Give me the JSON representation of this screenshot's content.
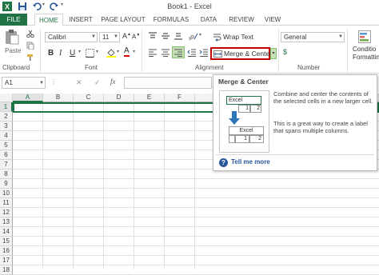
{
  "window": {
    "title": "Book1 - Excel"
  },
  "tabs": [
    "FILE",
    "HOME",
    "INSERT",
    "PAGE LAYOUT",
    "FORMULAS",
    "DATA",
    "REVIEW",
    "VIEW"
  ],
  "ribbon": {
    "clipboard": {
      "label": "Clipboard",
      "paste_label": "Paste"
    },
    "font": {
      "label": "Font",
      "font_name": "Calibri",
      "font_size": "11"
    },
    "alignment": {
      "label": "Alignment",
      "wrap_text": "Wrap Text",
      "merge_center": "Merge & Center"
    },
    "number": {
      "label": "Number",
      "format": "General"
    },
    "styles": {
      "conditional_line1": "Conditio",
      "conditional_line2": "Formattin"
    }
  },
  "formula_bar": {
    "name_box": "A1",
    "fx_label": "fx"
  },
  "grid": {
    "columns": [
      "A",
      "B",
      "C",
      "D",
      "E",
      "F"
    ],
    "rows": [
      "1",
      "2",
      "3",
      "4",
      "5",
      "6",
      "7",
      "8",
      "9",
      "10",
      "11",
      "12",
      "13",
      "14",
      "15",
      "16",
      "17",
      "18"
    ]
  },
  "tooltip": {
    "title": "Merge & Center",
    "description": "Combine and center the contents of the selected cells in a new larger cell.",
    "tip": "This is a great way to create a label that spans multiple columns.",
    "link": "Tell me more",
    "example_before": {
      "text": "Excel",
      "val1": "1",
      "val2": "2"
    },
    "example_after": {
      "text": "Excel",
      "val1": "1",
      "val2": "2"
    }
  },
  "colors": {
    "accent": "#217346",
    "highlight_border": "#c00000",
    "link": "#2b579a"
  }
}
